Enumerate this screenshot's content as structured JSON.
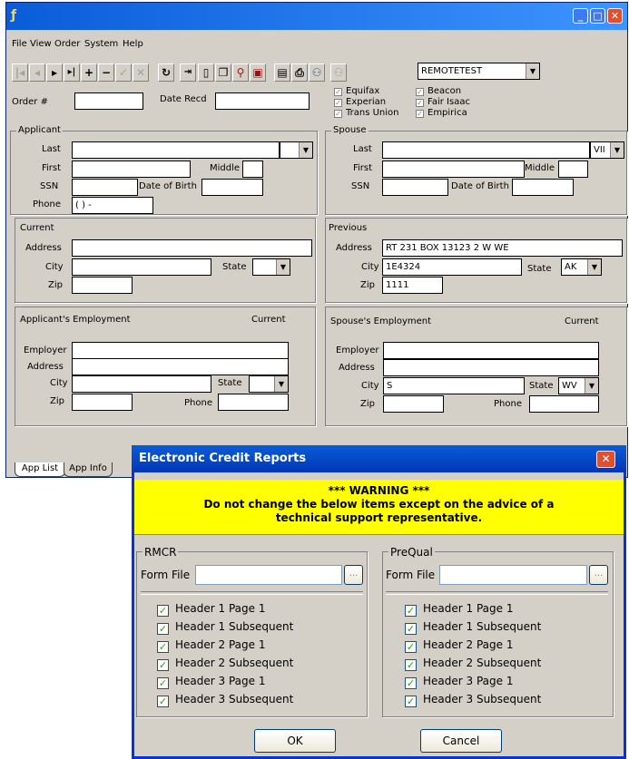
{
  "main_window": {
    "menu": [
      "File",
      "View",
      "Order",
      "System",
      "Help"
    ],
    "toolbar": {
      "remote_select": "REMOTETEST"
    },
    "order": {
      "order_label": "Order #",
      "date_label": "Date Recd",
      "order_value": "",
      "date_value": ""
    },
    "bureaus": [
      {
        "label": "Equifax",
        "checked": true
      },
      {
        "label": "Experian",
        "checked": true
      },
      {
        "label": "Trans Union",
        "checked": true
      },
      {
        "label": "Beacon",
        "checked": true
      },
      {
        "label": "Fair Isaac",
        "checked": true
      },
      {
        "label": "Empirica",
        "checked": true
      }
    ],
    "applicant": {
      "title": "Applicant",
      "last_label": "Last",
      "first_label": "First",
      "middle_label": "Middle",
      "ssn_label": "SSN",
      "dob_label": "Date of Birth",
      "phone_label": "Phone",
      "phone_value": "(   )    -"
    },
    "spouse": {
      "title": "Spouse",
      "last_label": "Last",
      "first_label": "First",
      "middle_label": "Middle",
      "ssn_label": "SSN",
      "dob_label": "Date of Birth",
      "suffix_value": "VII"
    },
    "current": {
      "title": "Current",
      "address_label": "Address",
      "city_label": "City",
      "state_label": "State",
      "zip_label": "Zip"
    },
    "previous": {
      "title": "Previous",
      "address_label": "Address",
      "city_label": "City",
      "state_label": "State",
      "zip_label": "Zip",
      "address_value": "RT 231 BOX 13123 2 W WE",
      "city_value": "1E4324",
      "state_value": "AK",
      "zip_value": "1111"
    },
    "applicant_employment": {
      "title": "Applicant's Employment",
      "current_label": "Current",
      "employer_label": "Employer",
      "address_label": "Address",
      "city_label": "City",
      "state_label": "State",
      "zip_label": "Zip",
      "phone_label": "Phone"
    },
    "spouse_employment": {
      "title": "Spouse's Employment",
      "current_label": "Current",
      "employer_label": "Employer",
      "address_label": "Address",
      "city_label": "City",
      "state_label": "State",
      "zip_label": "Zip",
      "phone_label": "Phone",
      "city_value": "S",
      "state_value": "WV"
    },
    "tabs": [
      "App List",
      "App Info"
    ]
  },
  "dialog": {
    "title": "Electronic Credit Reports",
    "warning_title": "*** WARNING ***",
    "warning_line1": "Do not change the below items except on the advice of a",
    "warning_line2": "technical support representative.",
    "rmcr": {
      "title": "RMCR",
      "form_file_label": "Form File",
      "browse": "...",
      "items": [
        "Header 1 Page 1",
        "Header 1 Subsequent",
        "Header 2 Page 1",
        "Header 2 Subsequent",
        "Header 3 Page 1",
        "Header 3 Subsequent"
      ]
    },
    "prequal": {
      "title": "PreQual",
      "form_file_label": "Form File",
      "browse": "...",
      "items": [
        "Header 1 Page 1",
        "Header 1 Subsequent",
        "Header 2 Page 1",
        "Header 2 Subsequent",
        "Header 3 Page 1",
        "Header 3 Subsequent"
      ]
    },
    "ok_label": "OK",
    "cancel_label": "Cancel",
    "close_glyph": "✕"
  }
}
